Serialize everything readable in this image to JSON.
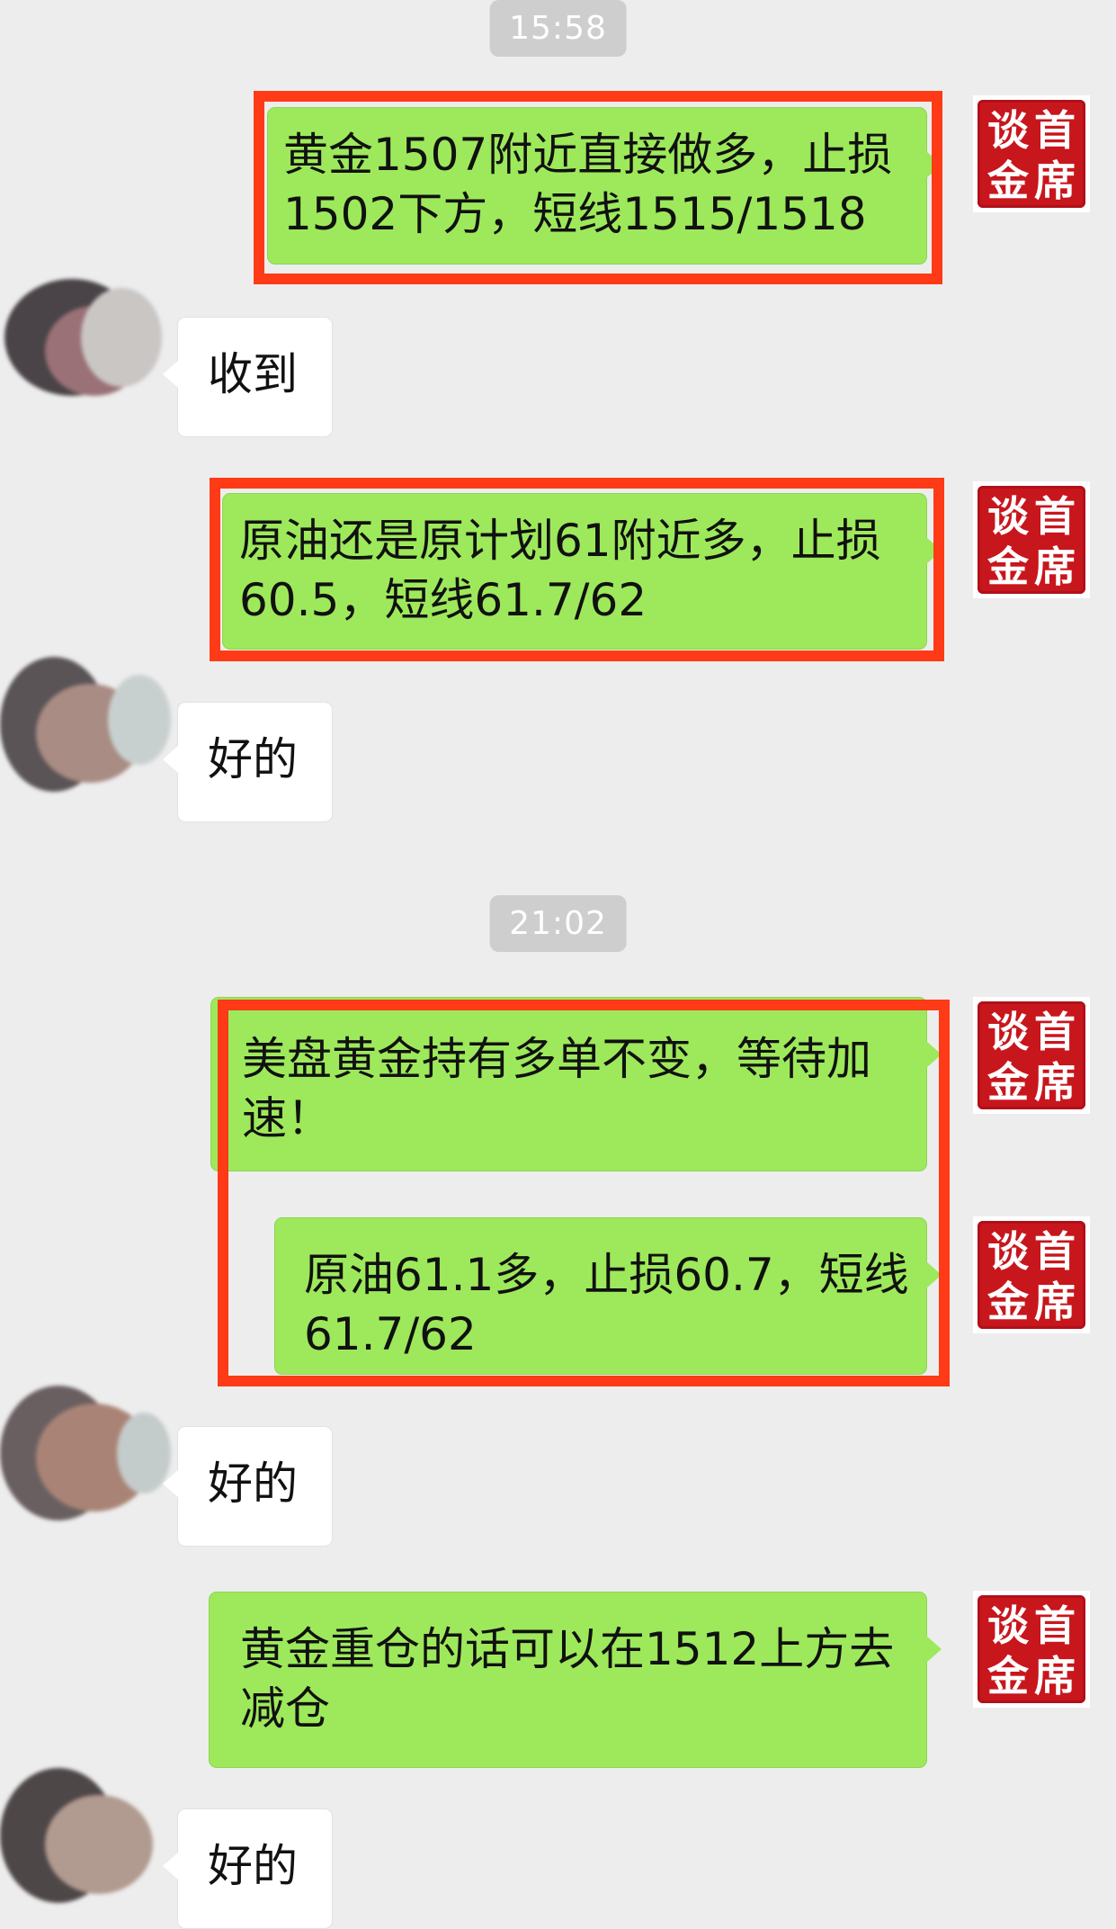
{
  "timestamps": [
    "15:58",
    "21:02"
  ],
  "messages": {
    "m1": "黄金1507附近直接做多，止损\n1502下方，短线1515/1518",
    "m2": "收到",
    "m3": "原油还是原计划61附近多，止损\n60.5，短线61.7/62",
    "m4": "好的",
    "m5": "美盘黄金持有多单不变，等待加\n速！",
    "m6": "原油61.1多，止损60.7，短线\n61.7/62",
    "m7": "好的",
    "m8": "黄金重仓的话可以在1512上方去\n减仓",
    "m9": "好的"
  },
  "seal": [
    "谈",
    "首",
    "金",
    "席"
  ],
  "colors": {
    "background": "#ededed",
    "outgoing_bubble": "#9de95b",
    "incoming_bubble": "#ffffff",
    "highlight_box": "#ff3a16",
    "seal_red": "#c8161d"
  }
}
